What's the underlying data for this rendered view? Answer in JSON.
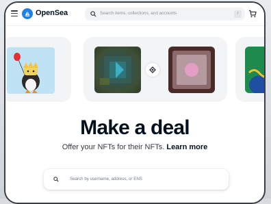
{
  "navbar": {
    "brand": "OpenSea",
    "search_placeholder": "Search items, collections, and accounts",
    "search_shortcut": "/",
    "menu_icon": "hamburger-menu-icon",
    "cart_icon": "cart-icon"
  },
  "hero": {
    "headline": "Make a deal",
    "subtitle": "Offer your NFTs for their NFTs.",
    "learn_more": "Learn more",
    "swap_icon": "swap-icon"
  },
  "deal_search": {
    "placeholder": "Search by username, address, or ENS"
  },
  "colors": {
    "brand_blue": "#2081e2",
    "text_dark": "#04111d"
  }
}
